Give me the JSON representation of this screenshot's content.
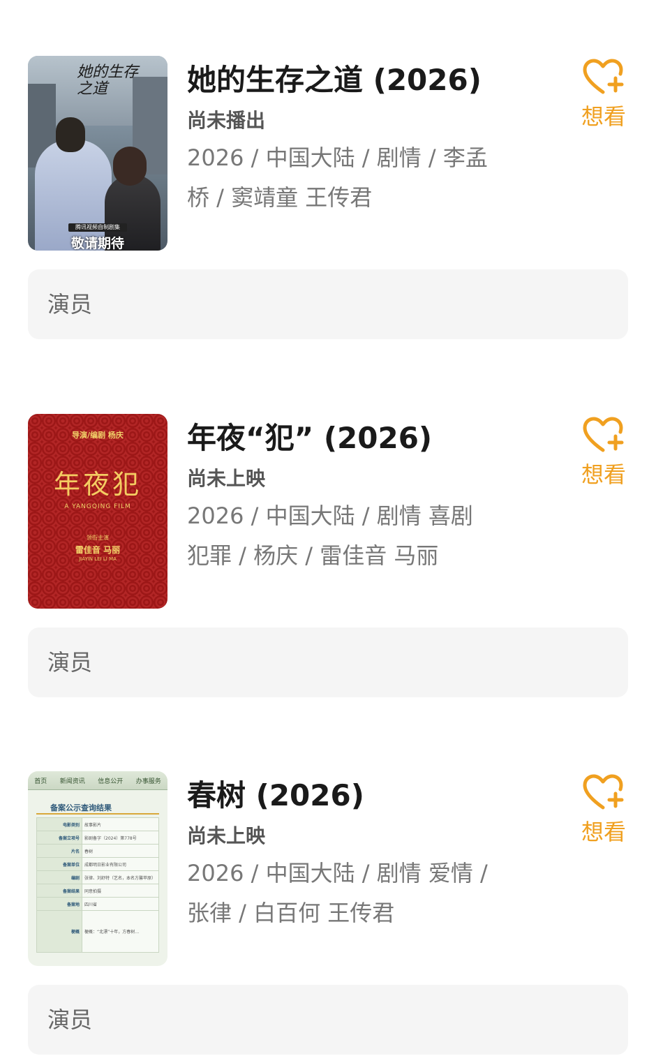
{
  "movies": [
    {
      "title": "她的生存之道 (2026)",
      "status": "尚未播出",
      "info": "2026 / 中国大陆 / 剧情 / 李孟桥 / 窦靖童 王传君",
      "want_label": "想看",
      "cast_label": "演员",
      "poster": {
        "title_text": "她的生存之道",
        "badge_small": "腾讯视频自制剧集",
        "badge_big": "敬请期待"
      }
    },
    {
      "title": "年夜“犯” (2026)",
      "status": "尚未上映",
      "info": "2026 / 中国大陆 / 剧情 喜剧犯罪 / 杨庆 / 雷佳音 马丽",
      "want_label": "想看",
      "cast_label": "演员",
      "poster": {
        "director_line": "导演/编剧  杨庆",
        "title_text": "年夜犯",
        "subtitle": "A YANGQING FILM",
        "coming": "领衔主演",
        "names": "雷佳音        马丽",
        "names_en": "JIAYIN LEI            LI MA"
      }
    },
    {
      "title": "春树 (2026)",
      "status": "尚未上映",
      "info": "2026 / 中国大陆 / 剧情 爱情 / 张律 / 白百何 王传君",
      "want_label": "想看",
      "cast_label": "演员",
      "poster": {
        "nav": [
          "首页",
          "新闻资讯",
          "信息公开",
          "办事服务"
        ],
        "heading": "备案公示查询结果",
        "rows": [
          {
            "k": "电影类别",
            "v": "故事影片"
          },
          {
            "k": "备案立项号",
            "v": "影剧备字（2024）第778号"
          },
          {
            "k": "片名",
            "v": "春树"
          },
          {
            "k": "备案单位",
            "v": "成都明日影业有限公司"
          },
          {
            "k": "编剧",
            "v": "张律、刘舒特（艺名，本名方馨苹原）"
          },
          {
            "k": "备案结果",
            "v": "同意拍摄"
          },
          {
            "k": "备案地",
            "v": "四川省"
          },
          {
            "k": "梗概",
            "v": "梗概：“北漂”十年，方春树…"
          }
        ]
      }
    }
  ],
  "colors": {
    "accent": "#f0a020",
    "title": "#1a1a1a",
    "info": "#777777",
    "cast_bg": "#f5f5f5"
  },
  "icons": {
    "want": "heart-plus-icon"
  }
}
